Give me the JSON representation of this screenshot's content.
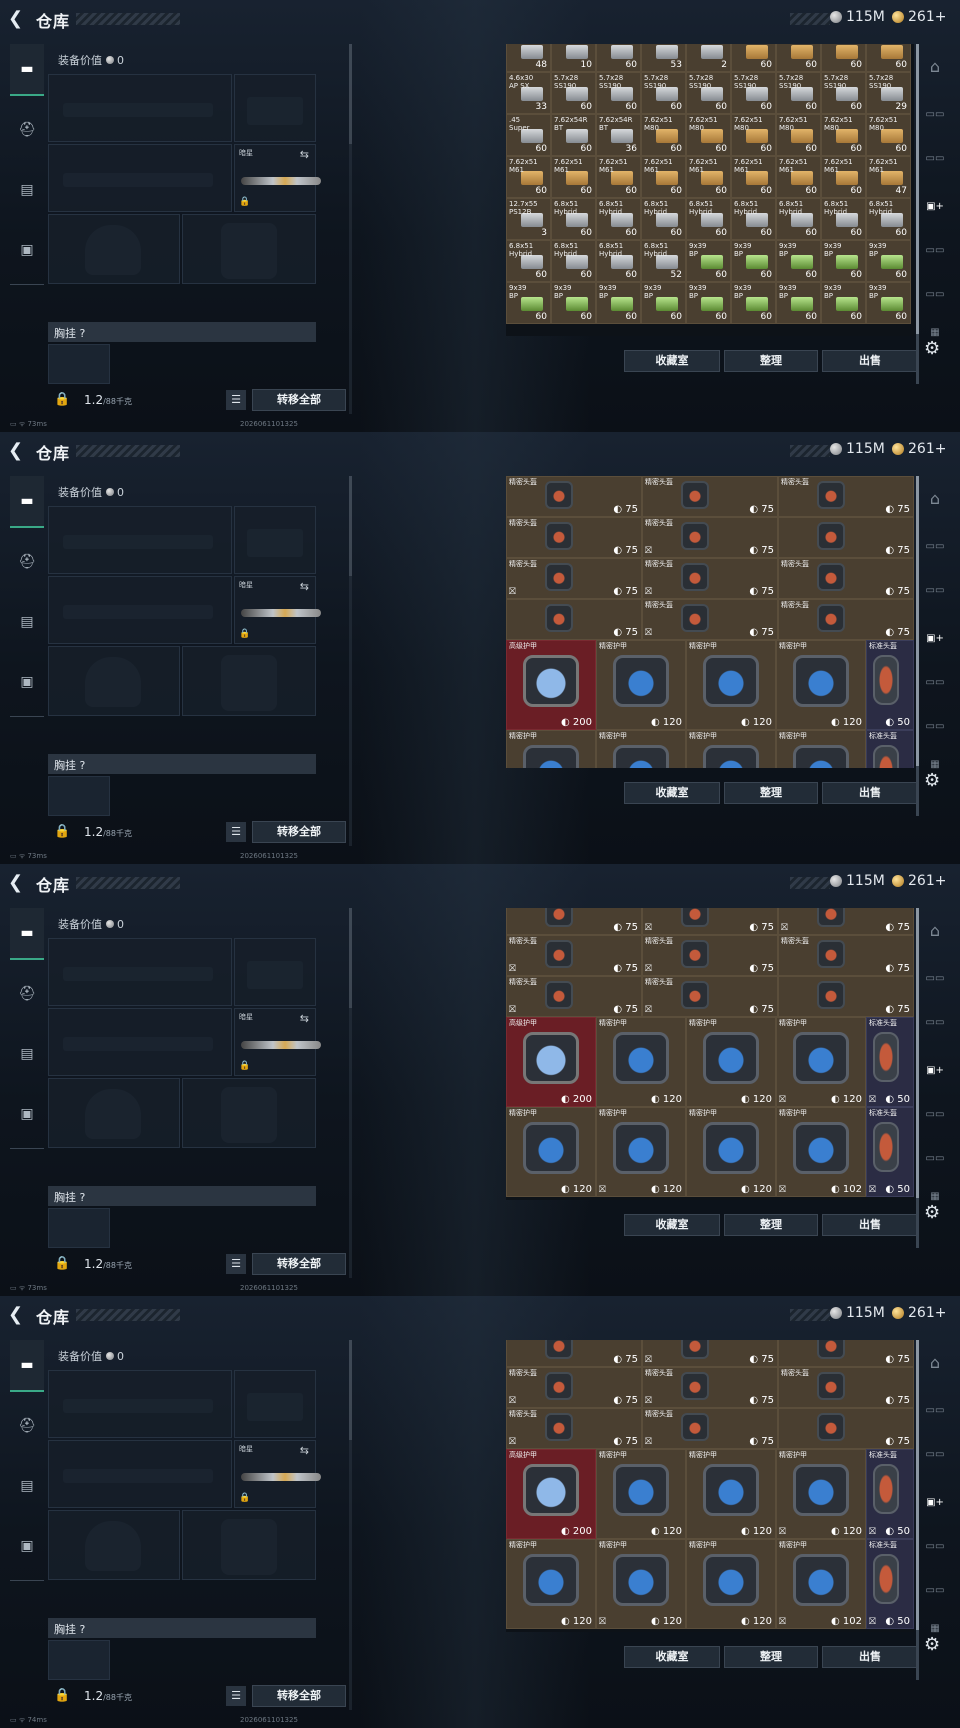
{
  "header": {
    "title": "仓库",
    "currency_1": "115M",
    "currency_2": "261+"
  },
  "equipment": {
    "value_label": "装备价值",
    "value": "0",
    "melee_label": "暗星",
    "chest_label": "胸挂 ?",
    "weight": "1.2",
    "weight_max": "/88千克",
    "transfer_all": "转移全部"
  },
  "actions": {
    "collection": "收藏室",
    "organize": "整理",
    "sell": "出售"
  },
  "frames": [
    {
      "status": "73ms",
      "stamp": "2026061101325",
      "stash_rows": [
        [
          {
            "n": "",
            "c": "48",
            "k": "g"
          },
          {
            "n": "",
            "c": "10",
            "k": "g"
          },
          {
            "n": "",
            "c": "60",
            "k": "g"
          },
          {
            "n": "",
            "c": "53",
            "k": "g"
          },
          {
            "n": "",
            "c": "2",
            "k": "g"
          },
          {
            "n": "",
            "c": "60",
            "k": "a"
          },
          {
            "n": "",
            "c": "60",
            "k": "a"
          },
          {
            "n": "",
            "c": "60",
            "k": "a"
          },
          {
            "n": "",
            "c": "60",
            "k": "a"
          }
        ],
        [
          {
            "n": "4.6x30\nAP SX",
            "c": "33",
            "k": "g"
          },
          {
            "n": "5.7x28\nSS190",
            "c": "60",
            "k": "g"
          },
          {
            "n": "5.7x28\nSS190",
            "c": "60",
            "k": "g"
          },
          {
            "n": "5.7x28\nSS190",
            "c": "60",
            "k": "g"
          },
          {
            "n": "5.7x28\nSS190",
            "c": "60",
            "k": "g"
          },
          {
            "n": "5.7x28\nSS190",
            "c": "60",
            "k": "g"
          },
          {
            "n": "5.7x28\nSS190",
            "c": "60",
            "k": "g"
          },
          {
            "n": "5.7x28\nSS190",
            "c": "60",
            "k": "g"
          },
          {
            "n": "5.7x28\nSS190",
            "c": "29",
            "k": "g"
          }
        ],
        [
          {
            "n": ".45\nSuper",
            "c": "60",
            "k": "g"
          },
          {
            "n": "7.62x54R\nBT",
            "c": "60",
            "k": "g"
          },
          {
            "n": "7.62x54R\nBT",
            "c": "36",
            "k": "g"
          },
          {
            "n": "7.62x51\nM80",
            "c": "60",
            "k": "a"
          },
          {
            "n": "7.62x51\nM80",
            "c": "60",
            "k": "a"
          },
          {
            "n": "7.62x51\nM80",
            "c": "60",
            "k": "a"
          },
          {
            "n": "7.62x51\nM80",
            "c": "60",
            "k": "a"
          },
          {
            "n": "7.62x51\nM80",
            "c": "60",
            "k": "a"
          },
          {
            "n": "7.62x51\nM80",
            "c": "60",
            "k": "a"
          }
        ],
        [
          {
            "n": "7.62x51\nM61",
            "c": "60",
            "k": "a"
          },
          {
            "n": "7.62x51\nM61",
            "c": "60",
            "k": "a"
          },
          {
            "n": "7.62x51\nM61",
            "c": "60",
            "k": "a"
          },
          {
            "n": "7.62x51\nM61",
            "c": "60",
            "k": "a"
          },
          {
            "n": "7.62x51\nM61",
            "c": "60",
            "k": "a"
          },
          {
            "n": "7.62x51\nM61",
            "c": "60",
            "k": "a"
          },
          {
            "n": "7.62x51\nM61",
            "c": "60",
            "k": "a"
          },
          {
            "n": "7.62x51\nM61",
            "c": "60",
            "k": "a"
          },
          {
            "n": "7.62x51\nM61",
            "c": "47",
            "k": "a"
          }
        ],
        [
          {
            "n": "12.7x55\nPS12B",
            "c": "3",
            "k": "g"
          },
          {
            "n": "6.8x51\nHybrid",
            "c": "60",
            "k": "g"
          },
          {
            "n": "6.8x51\nHybrid",
            "c": "60",
            "k": "g"
          },
          {
            "n": "6.8x51\nHybrid",
            "c": "60",
            "k": "g"
          },
          {
            "n": "6.8x51\nHybrid",
            "c": "60",
            "k": "g"
          },
          {
            "n": "6.8x51\nHybrid",
            "c": "60",
            "k": "g"
          },
          {
            "n": "6.8x51\nHybrid",
            "c": "60",
            "k": "g"
          },
          {
            "n": "6.8x51\nHybrid",
            "c": "60",
            "k": "g"
          },
          {
            "n": "6.8x51\nHybrid",
            "c": "60",
            "k": "g"
          }
        ],
        [
          {
            "n": "6.8x51\nHybrid",
            "c": "60",
            "k": "g"
          },
          {
            "n": "6.8x51\nHybrid",
            "c": "60",
            "k": "g"
          },
          {
            "n": "6.8x51\nHybrid",
            "c": "60",
            "k": "g"
          },
          {
            "n": "6.8x51\nHybrid",
            "c": "52",
            "k": "g"
          },
          {
            "n": "9x39\nBP",
            "c": "60",
            "k": "n"
          },
          {
            "n": "9x39\nBP",
            "c": "60",
            "k": "n"
          },
          {
            "n": "9x39\nBP",
            "c": "60",
            "k": "n"
          },
          {
            "n": "9x39\nBP",
            "c": "60",
            "k": "n"
          },
          {
            "n": "9x39\nBP",
            "c": "60",
            "k": "n"
          }
        ],
        [
          {
            "n": "9x39\nBP",
            "c": "60",
            "k": "n"
          },
          {
            "n": "9x39\nBP",
            "c": "60",
            "k": "n"
          },
          {
            "n": "9x39\nBP",
            "c": "60",
            "k": "n"
          },
          {
            "n": "9x39\nBP",
            "c": "60",
            "k": "n"
          },
          {
            "n": "9x39\nBP",
            "c": "60",
            "k": "n"
          },
          {
            "n": "9x39\nBP",
            "c": "60",
            "k": "n"
          },
          {
            "n": "9x39\nBP",
            "c": "60",
            "k": "n"
          },
          {
            "n": "9x39\nBP",
            "c": "60",
            "k": "n"
          },
          {
            "n": "9x39\nBP",
            "c": "60",
            "k": "n"
          }
        ]
      ]
    },
    {
      "status": "73ms",
      "stamp": "2026061101325",
      "helm_rows": [
        [
          {
            "n": "精密头盔",
            "d": "75",
            "t": ""
          },
          {
            "n": "精密头盔",
            "d": "75",
            "t": ""
          },
          {
            "n": "精密头盔",
            "d": "75",
            "t": ""
          }
        ],
        [
          {
            "n": "精密头盔",
            "d": "75",
            "t": ""
          },
          {
            "n": "精密头盔",
            "d": "75",
            "t": "⛝"
          },
          {
            "n": "",
            "d": "75",
            "t": ""
          }
        ],
        [
          {
            "n": "精密头盔",
            "d": "75",
            "t": "⛝"
          },
          {
            "n": "精密头盔",
            "d": "75",
            "t": "⛝"
          },
          {
            "n": "精密头盔",
            "d": "75",
            "t": ""
          }
        ],
        [
          {
            "n": "",
            "d": "75",
            "t": ""
          },
          {
            "n": "精密头盔",
            "d": "75",
            "t": "⛝"
          },
          {
            "n": "精密头盔",
            "d": "75",
            "t": ""
          }
        ]
      ],
      "armor_rows": [
        [
          {
            "n": "高级护甲",
            "d": "200",
            "t": "",
            "hi": true
          },
          {
            "n": "精密护甲",
            "d": "120",
            "t": ""
          },
          {
            "n": "精密护甲",
            "d": "120",
            "t": ""
          },
          {
            "n": "精密护甲",
            "d": "120",
            "t": ""
          },
          {
            "n": "标准头盔",
            "d": "50",
            "t": ""
          }
        ],
        [
          {
            "n": "精密护甲",
            "d": "",
            "t": ""
          },
          {
            "n": "精密护甲",
            "d": "",
            "t": ""
          },
          {
            "n": "精密护甲",
            "d": "",
            "t": ""
          },
          {
            "n": "精密护甲",
            "d": "",
            "t": ""
          },
          {
            "n": "标准头盔",
            "d": "",
            "t": ""
          }
        ]
      ]
    },
    {
      "status": "73ms",
      "stamp": "2026061101325",
      "helm_rows": [
        [
          {
            "n": "",
            "d": "75",
            "t": ""
          },
          {
            "n": "",
            "d": "75",
            "t": "⛝"
          },
          {
            "n": "",
            "d": "75",
            "t": "⛝"
          }
        ],
        [
          {
            "n": "精密头盔",
            "d": "75",
            "t": "⛝"
          },
          {
            "n": "精密头盔",
            "d": "75",
            "t": "⛝"
          },
          {
            "n": "精密头盔",
            "d": "75",
            "t": ""
          }
        ],
        [
          {
            "n": "精密头盔",
            "d": "75",
            "t": "⛝"
          },
          {
            "n": "精密头盔",
            "d": "75",
            "t": "⛝"
          },
          {
            "n": "",
            "d": "75",
            "t": ""
          }
        ]
      ],
      "armor_rows": [
        [
          {
            "n": "高级护甲",
            "d": "200",
            "t": "",
            "hi": true
          },
          {
            "n": "精密护甲",
            "d": "120",
            "t": ""
          },
          {
            "n": "精密护甲",
            "d": "120",
            "t": ""
          },
          {
            "n": "精密护甲",
            "d": "120",
            "t": "⛝"
          },
          {
            "n": "标准头盔",
            "d": "50",
            "t": "⛝"
          }
        ],
        [
          {
            "n": "精密护甲",
            "d": "120",
            "t": ""
          },
          {
            "n": "精密护甲",
            "d": "120",
            "t": "⛝"
          },
          {
            "n": "精密护甲",
            "d": "120",
            "t": ""
          },
          {
            "n": "精密护甲",
            "d": "102",
            "t": "⛝"
          },
          {
            "n": "标准头盔",
            "d": "50",
            "t": "⛝"
          }
        ]
      ]
    },
    {
      "status": "74ms",
      "stamp": "2026061101325",
      "helm_rows": [
        [
          {
            "n": "",
            "d": "75",
            "t": ""
          },
          {
            "n": "",
            "d": "75",
            "t": "⛝"
          },
          {
            "n": "",
            "d": "75",
            "t": ""
          }
        ],
        [
          {
            "n": "精密头盔",
            "d": "75",
            "t": "⛝"
          },
          {
            "n": "精密头盔",
            "d": "75",
            "t": "⛝"
          },
          {
            "n": "精密头盔",
            "d": "75",
            "t": ""
          }
        ],
        [
          {
            "n": "精密头盔",
            "d": "75",
            "t": "⛝"
          },
          {
            "n": "精密头盔",
            "d": "75",
            "t": "⛝"
          },
          {
            "n": "",
            "d": "75",
            "t": ""
          }
        ]
      ],
      "armor_rows": [
        [
          {
            "n": "高级护甲",
            "d": "200",
            "t": "",
            "hi": true
          },
          {
            "n": "精密护甲",
            "d": "120",
            "t": ""
          },
          {
            "n": "精密护甲",
            "d": "120",
            "t": ""
          },
          {
            "n": "精密护甲",
            "d": "120",
            "t": "⛝"
          },
          {
            "n": "标准头盔",
            "d": "50",
            "t": "⛝"
          }
        ],
        [
          {
            "n": "精密护甲",
            "d": "120",
            "t": ""
          },
          {
            "n": "精密护甲",
            "d": "120",
            "t": "⛝"
          },
          {
            "n": "精密护甲",
            "d": "120",
            "t": ""
          },
          {
            "n": "精密护甲",
            "d": "102",
            "t": "⛝"
          },
          {
            "n": "标准头盔",
            "d": "50",
            "t": "⛝"
          }
        ]
      ]
    }
  ]
}
